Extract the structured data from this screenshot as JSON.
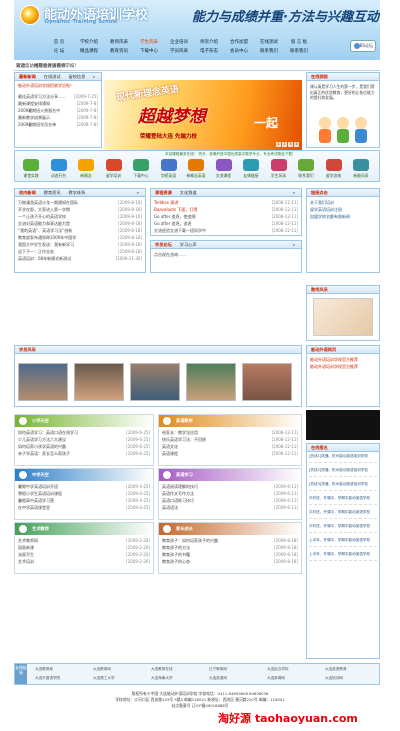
{
  "header": {
    "site_name": "能动外语培训学校",
    "site_name_en": "Dynamic Training School",
    "slogan": "能力与成绩并重·方法与兴趣互动",
    "bbs_label": "BBS论坛",
    "nav_row1": [
      "首 页",
      "学校介绍",
      "教师风采",
      "学生风采",
      "企业培训",
      "师资介绍",
      "合作加盟",
      "在线测试",
      "留 言 板"
    ],
    "nav_row2": [
      "论 坛",
      "精品课程",
      "教育资讯",
      "下载中心",
      "学员风采",
      "电子杂志",
      "会员中心",
      "联系我们",
      "联系我们"
    ],
    "nav_active": "学生风采"
  },
  "notice": {
    "text": "滚动……推荐名优质教师……",
    "welcome": "欢迎您访问能动外语培训学校！"
  },
  "news": {
    "tabs": [
      "最新新闻",
      "在线测试",
      "留校信息"
    ],
    "headline": "能动外语培训学校招收学员啦！",
    "items": [
      {
        "t": "最佳英语学习方法分享……",
        "d": "[2009-7-25]"
      },
      {
        "t": "最新课程安排通知",
        "d": "[2009-7-8]"
      },
      {
        "t": "2009暑期班火热报名中",
        "d": "[2009-7-8]"
      },
      {
        "t": "最新教学成果展示",
        "d": "[2009-7-8]"
      },
      {
        "t": "2009暑期班学员名单",
        "d": "[2009-7-8]"
      }
    ]
  },
  "banner": {
    "line1": "现代新理念英语",
    "line2": "超越梦想",
    "line3": "一起",
    "line4": "荣耀登陆大连  先端力校",
    "pages": [
      "1",
      "2",
      "3",
      "4"
    ]
  },
  "about": {
    "title": "在线测验",
    "text": "课认真是学习人生的第一步，是我们得出真正的优质教育，更好的让各位能力的提升和发展。"
  },
  "icon_bar": {
    "marquee": "本站课程最多在线！ 同步，准确开放中国优秀高中数学专业，专业考试精品下载！",
    "items": [
      {
        "label": "课堂实践",
        "color": "#5cae3a"
      },
      {
        "label": "动态开台",
        "color": "#2f8fd8"
      },
      {
        "label": "新概念",
        "color": "#f4a300"
      },
      {
        "label": "留学培训",
        "color": "#d84a2b"
      },
      {
        "label": "下载中心",
        "color": "#3aa06a"
      },
      {
        "label": "剑桥英语",
        "color": "#4775c8"
      },
      {
        "label": "新概念英语",
        "color": "#e27a00"
      },
      {
        "label": "交流课程",
        "color": "#8a56c4"
      },
      {
        "label": "友情链接",
        "color": "#2e9bb0"
      },
      {
        "label": "学生风采",
        "color": "#cc3d6b"
      },
      {
        "label": "联系我们",
        "color": "#6aa73a"
      },
      {
        "label": "留学咨询",
        "color": "#d0483a"
      },
      {
        "label": "新能风采",
        "color": "#3b8f9e"
      }
    ]
  },
  "school_news": {
    "tabs": [
      "校内新闻",
      "教育资讯",
      "教学体系"
    ],
    "items": [
      {
        "t": "万物漫游英语沙龙一期通知在国际",
        "d": "[2009-8-18]"
      },
      {
        "t": "开学在即，大家进入第一学期",
        "d": "[2009-8-18]"
      },
      {
        "t": "一个让孩子开心的英语学校",
        "d": "[2009-8-10]"
      },
      {
        "t": "交流对英语能力和表达能力是",
        "d": "[2009-8-18]"
      },
      {
        "t": "“我的英语”、英语学习法“创新",
        "d": "[2009-8-18]"
      },
      {
        "t": "教育部发布通知称2009年中国学",
        "d": "[2009-8-18]"
      },
      {
        "t": "我国大中学生发送：我有新学习",
        "d": "[2009-8-18]"
      },
      {
        "t": "这下子一：正作业务",
        "d": "[2009-8-18]"
      },
      {
        "t": "英语培训：08年新模式新测试",
        "d": "[2009-11-30]"
      }
    ]
  },
  "resources": {
    "tabs": [
      "课程资源",
      "文化频道"
    ],
    "items": [
      {
        "t": "Teddies 演讲",
        "d": "[2008-12-11]"
      },
      {
        "t": "Baavaloots 下面，打得",
        "d": "[2008-12-11]"
      },
      {
        "t": "Go after 追逐，使追随",
        "d": "[2008-12-11]"
      },
      {
        "t": "Go after 追逐，追逐",
        "d": "[2008-12-11]"
      },
      {
        "t": "交流经验交流下载一班同学中",
        "d": "[2008-12-11]"
      }
    ]
  },
  "forum": {
    "tabs": [
      "学员论坛",
      "学习心声"
    ],
    "text": "点击现在咨询……"
  },
  "links_box": {
    "title": "链接点击",
    "items": [
      "关于我们培训",
      "留学英语培训注册",
      "加盟学校名额有限新闻"
    ]
  },
  "teacher_box": {
    "title": "教师风采"
  },
  "photos": {
    "title": "学员风采"
  },
  "right_links": {
    "title": "能动外语网页",
    "items": [
      "能动外语培训学校官方推荐",
      "能动外语培训学校官方推荐"
    ]
  },
  "subjects": [
    {
      "title": "小学天空",
      "color": "#78b532",
      "items": [
        {
          "t": "如何英语学习：英语口语在线学习",
          "d": "[2009-6-25]"
        },
        {
          "t": "少儿英语学习方法六大建议",
          "d": "[2009-6-25]"
        },
        {
          "t": "如何培养小孩学英语的兴趣",
          "d": "[2009-6-25]"
        },
        {
          "t": "亲子学英语：家长怎么帮孩子",
          "d": "[2009-6-25]"
        }
      ]
    },
    {
      "title": "英语教学",
      "color": "#e08b1a",
      "items": [
        {
          "t": "给家长：教学法应用",
          "d": "[2008-12-11]"
        },
        {
          "t": "快乐英语学习法：不回馈",
          "d": "[2008-12-11]"
        },
        {
          "t": "英语文化",
          "d": "[2008-12-11]"
        },
        {
          "t": "英语课程",
          "d": "[2008-12-11]"
        }
      ]
    },
    {
      "title": "中学天空",
      "color": "#2f80c8",
      "items": [
        {
          "t": "暑期中学英语培训开班",
          "d": "[2009-4-25]"
        },
        {
          "t": "寒假小学生英语培训课程",
          "d": "[2009-4-25]"
        },
        {
          "t": "暑假高中英语学习营",
          "d": "[2009-4-25]"
        },
        {
          "t": "在中学英语课堂里",
          "d": "[2009-4-25]"
        }
      ]
    },
    {
      "title": "英语学习",
      "color": "#a85cc4",
      "items": [
        {
          "t": "英语阅读理解的技巧",
          "d": "[2009-6-11]"
        },
        {
          "t": "英语作文写作方法",
          "d": "[2009-6-11]"
        },
        {
          "t": "英语口语练习技巧",
          "d": "[2009-6-11]"
        },
        {
          "t": "英语语法",
          "d": "[2009-6-11]"
        }
      ]
    },
    {
      "title": "艺术教师",
      "color": "#48a05a",
      "items": [
        {
          "t": "艺术教师网",
          "d": "[2009-2-28]"
        },
        {
          "t": "国画新课",
          "d": "[2009-2-20]"
        },
        {
          "t": "油画写生",
          "d": "[2009-2-20]"
        },
        {
          "t": "艺术培训",
          "d": "[2009-2-20]"
        }
      ]
    },
    {
      "title": "家长成长",
      "color": "#c46a2f",
      "items": [
        {
          "t": "教育孩子：如何培养孩子的兴趣",
          "d": "[2009-8-18]"
        },
        {
          "t": "教育孩子的方法",
          "d": "[2009-8-18]"
        },
        {
          "t": "教育孩子的书籍",
          "d": "[2009-8-18]"
        },
        {
          "t": "教育孩子的心态",
          "d": "[2009-8-18]"
        }
      ]
    }
  ],
  "ads": {
    "title": "在线报名",
    "items": [
      "[热线1]拨通，杭州能动英语培训学校",
      "[热线2]拨通，杭州能动英语培训学校",
      "[热线3]拨通，杭州能动英语培训学校",
      "平时班，开课中，学期中能动英语学校",
      "平时班，开课中，学期中能动英语学校",
      "平时班，开课中，学期中能动英语学校",
      "上半年，开课中，学期中能动英语学校",
      "上半年，开课中，学期中能动英语学校"
    ]
  },
  "footer": {
    "label": "友情链接",
    "links": [
      "大连教育局",
      "大连教育网",
      "大连教育在线",
      "辽宁教育网",
      "大连民办学校",
      "大连英语教育",
      "大连外国语学院",
      "大连理工大学",
      "大连海事大学",
      "大连英语网",
      "大连新闻网",
      "大连培训网"
    ],
    "copyright": "版权所有©中国·大连能动外语培训学校  学校电话：0411-84609608 84608038",
    "address": "学校地址：沙河口区·西安路103号 3楼4 邮编116021  新校址：西岗区·黄河路220号 邮编：116001",
    "icp": "站点备案号 辽ICP备09018888号",
    "watermark": "淘好源 taohaoyuan.com"
  }
}
